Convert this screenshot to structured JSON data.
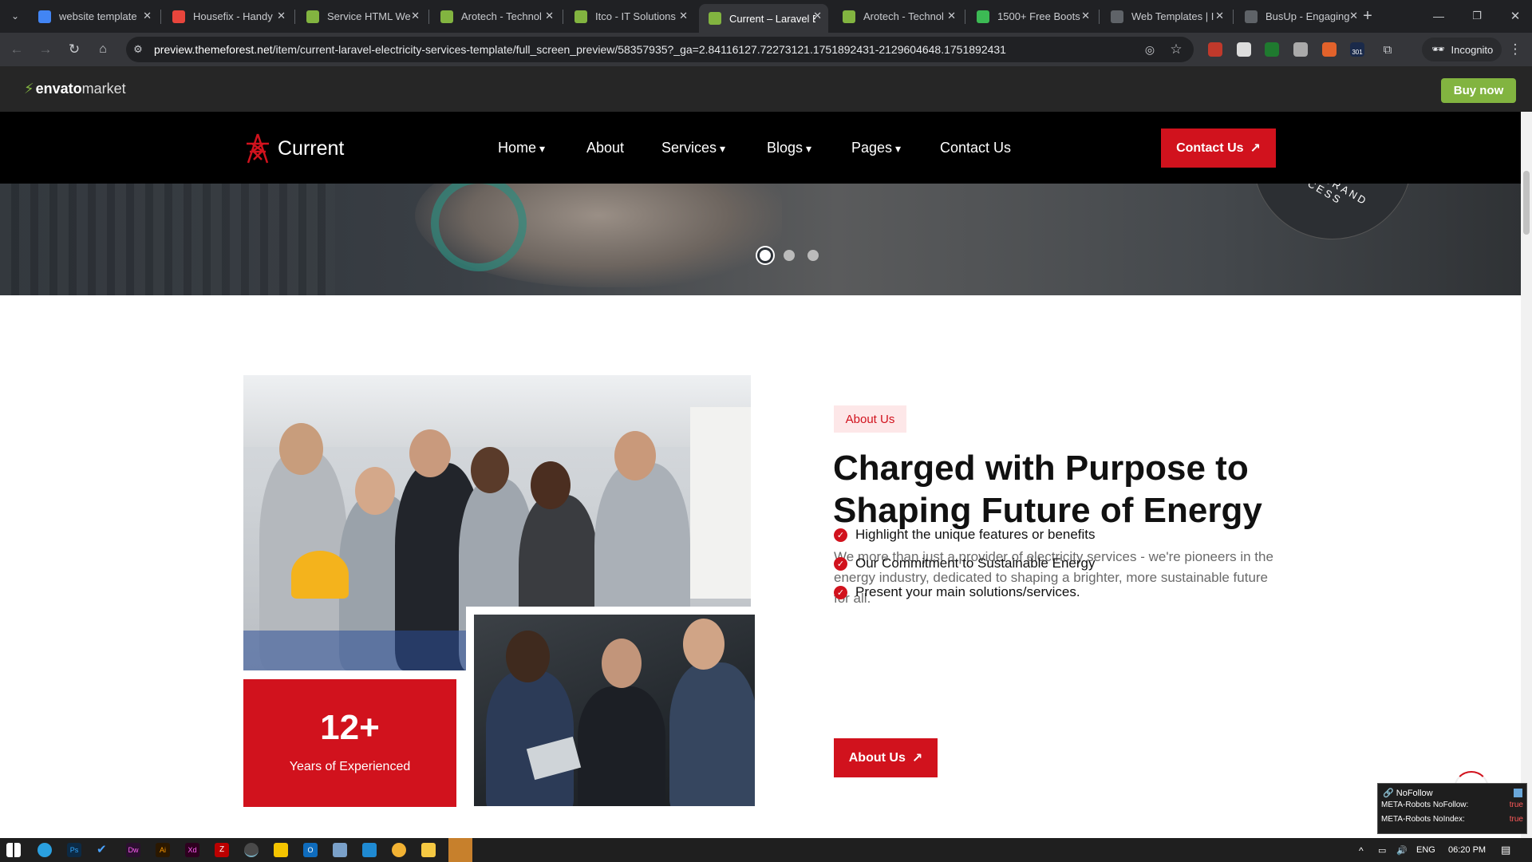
{
  "browser": {
    "tabs": [
      {
        "title": "website template",
        "color": "#4285f4"
      },
      {
        "title": "Housefix - Handy",
        "color": "#e8453c"
      },
      {
        "title": "Service HTML We",
        "color": "#82b440"
      },
      {
        "title": "Arotech - Technol",
        "color": "#82b440"
      },
      {
        "title": "Itco - IT Solutions",
        "color": "#82b440"
      },
      {
        "title": "Current – Laravel E",
        "color": "#82b440",
        "active": true
      },
      {
        "title": "Arotech - Technol",
        "color": "#82b440"
      },
      {
        "title": "1500+ Free Boots",
        "color": "#3cba54"
      },
      {
        "title": "Web Templates | I",
        "color": "#5f6368"
      },
      {
        "title": "BusUp - Engaging",
        "color": "#5f6368"
      }
    ],
    "url_host": "preview.themeforest.net",
    "url_path": "/item/current-laravel-electricity-services-template/full_screen_preview/58357935?_ga=2.84116127.72273121.1751892431-2129604648.1751892431",
    "incognito_label": "Incognito",
    "ext_badge": "301"
  },
  "envato": {
    "logo_bold": "envato",
    "logo_light": "market",
    "buy_label": "Buy now"
  },
  "nav": {
    "brand": "Current",
    "items": [
      {
        "label": "Home",
        "dropdown": true
      },
      {
        "label": "About",
        "dropdown": false
      },
      {
        "label": "Services",
        "dropdown": true
      },
      {
        "label": "Blogs",
        "dropdown": true
      },
      {
        "label": "Pages",
        "dropdown": true
      },
      {
        "label": "Contact Us",
        "dropdown": false
      }
    ],
    "cta_label": "Contact Us"
  },
  "hero": {
    "badge_text": "WITH BRAND SUCCESS",
    "slides": 3,
    "active_slide": 1
  },
  "about": {
    "tag": "About Us",
    "heading": "Charged with Purpose to Shaping Future of Energy",
    "paragraph": "We more than just a provider of electricity services - we're pioneers in the energy industry, dedicated to shaping a brighter, more sustainable future for all.",
    "checklist": [
      "Highlight the unique features or benefits",
      "Our Commitment to Sustainable Energy",
      "Present your main solutions/services."
    ],
    "button_label": "About Us",
    "stat_number": "12+",
    "stat_label": "Years of Experienced"
  },
  "seo_panel": {
    "title": "NoFollow",
    "rows": [
      {
        "label": "META-Robots NoFollow:",
        "value": "true"
      },
      {
        "label": "META-Robots NoIndex:",
        "value": "true"
      }
    ]
  },
  "taskbar": {
    "lang": "ENG",
    "time": "06:20 PM"
  },
  "colors": {
    "brand_red": "#d1121d",
    "envato_green": "#82b440"
  }
}
